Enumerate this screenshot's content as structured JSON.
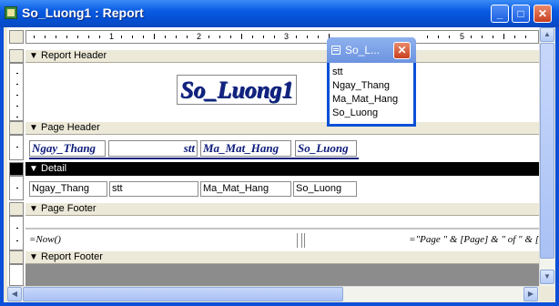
{
  "window": {
    "title": "So_Luong1 : Report",
    "minimize": "_",
    "maximize": "□",
    "close": "✕"
  },
  "ruler": {
    "numbers": [
      "1",
      "2",
      "3",
      "5"
    ]
  },
  "sections": {
    "report_header": "Report Header",
    "page_header": "Page Header",
    "detail": "Detail",
    "page_footer": "Page Footer",
    "report_footer": "Report Footer",
    "arrow": "🡇"
  },
  "report_header": {
    "title_label": "So_Luong1"
  },
  "page_header": {
    "labels": [
      "Ngay_Thang",
      "stt",
      "Ma_Mat_Hang",
      "So_Luong"
    ]
  },
  "detail": {
    "fields": [
      "Ngay_Thang",
      "stt",
      "Ma_Mat_Hang",
      "So_Luong"
    ]
  },
  "page_footer": {
    "now_expr": "=Now()",
    "page_expr": "=\"Page \" & [Page] & \" of \" & ["
  },
  "field_list": {
    "title": "So_L...",
    "close": "✕",
    "items": [
      "stt",
      "Ngay_Thang",
      "Ma_Mat_Hang",
      "So_Luong"
    ]
  }
}
